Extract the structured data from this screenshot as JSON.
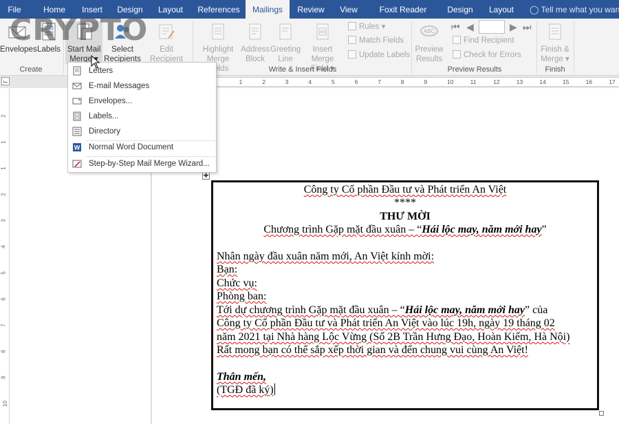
{
  "tabs": [
    "File",
    "Home",
    "Insert",
    "Design",
    "Layout",
    "References",
    "Mailings",
    "Review",
    "View",
    "Foxit Reader PDF",
    "Design",
    "Layout"
  ],
  "active_tab_index": 6,
  "tell_me": "Tell me what you want to do",
  "ribbon": {
    "create": {
      "envelopes": "Envelopes",
      "labels": "Labels",
      "group_label": "Create"
    },
    "start_mail_merge": {
      "start_line1": "Start Mail",
      "start_line2": "Merge",
      "select_line1": "Select",
      "select_line2": "Recipients",
      "edit_line1": "Edit",
      "edit_line2": "Recipient List"
    },
    "write_insert": {
      "highlight_line1": "Highlight",
      "highlight_line2": "Merge Fields",
      "address_line1": "Address",
      "address_line2": "Block",
      "greeting_line1": "Greeting",
      "greeting_line2": "Line",
      "insert_line1": "Insert Merge",
      "insert_line2": "Field",
      "rules": "Rules",
      "match_fields": "Match Fields",
      "update_labels": "Update Labels",
      "group_label": "Write & Insert Fields"
    },
    "preview": {
      "preview_line1": "Preview",
      "preview_line2": "Results",
      "find_recipient": "Find Recipient",
      "check_errors": "Check for Errors",
      "group_label": "Preview Results"
    },
    "finish": {
      "finish_line1": "Finish &",
      "finish_line2": "Merge",
      "group_label": "Finish"
    }
  },
  "watermark": "CRYPTO",
  "ruler_numbers": [
    "1",
    "2",
    "3",
    "4",
    "5",
    "6",
    "7",
    "8",
    "9",
    "10",
    "11",
    "12",
    "13",
    "14",
    "15",
    "16",
    "17"
  ],
  "vruler_numbers": [
    "2",
    "1",
    "1",
    "2",
    "3",
    "4",
    "5",
    "6",
    "7",
    "8",
    "9",
    "10",
    "11"
  ],
  "menu": {
    "items": [
      {
        "label": "Letters",
        "icon": "letter-icon"
      },
      {
        "label": "E-mail Messages",
        "icon": "email-icon"
      },
      {
        "label": "Envelopes...",
        "icon": "envelope-icon"
      },
      {
        "label": "Labels...",
        "icon": "labels-icon"
      },
      {
        "label": "Directory",
        "icon": "directory-icon"
      },
      {
        "label": "Normal Word Document",
        "icon": "word-icon"
      },
      {
        "label": "Step-by-Step Mail Merge Wizard...",
        "icon": "wizard-icon"
      }
    ]
  },
  "document": {
    "company": "Công ty Cổ phần Đầu tư và Phát triển An Việt",
    "stars": "****",
    "title": "THƯ MỜI",
    "program_prefix": "Chương trình Gặp mặt đầu xuân – “",
    "program_name": "Hái lộc may, năm mới hay",
    "program_suffix": "”",
    "greeting": "Nhân ngày đầu xuân năm mới, An Việt kính mời:",
    "field_ban": "Bạn:",
    "field_chucvu": "Chức vụ:",
    "field_phongban": "Phòng ban:",
    "body1_prefix": "Tới dự chương trình Gặp mặt đầu xuân – “",
    "body1_name": "Hái lộc may, năm mới hay",
    "body1_suffix": "” của",
    "body2": "Công ty Cổ phần Đầu tư và Phát triển An Việt vào lúc 19h, ngày 19 tháng 02",
    "body3": "năm 2021 tại Nhà hàng Lộc Vừng (Số 2B Trần Hưng Đạo, Hoàn Kiếm, Hà Nội)",
    "body4": "Rất mong bạn có thể sắp xếp thời gian và đến chung vui cùng An Việt!",
    "closing": "Thân mến,",
    "signature": "(TGĐ đã ký)"
  },
  "colors": {
    "ribbon_tab_bar": "#2b579a",
    "ribbon_bg": "#f3f3f3",
    "disabled_text": "#a6a6a6",
    "spell_error": "#d11111"
  }
}
